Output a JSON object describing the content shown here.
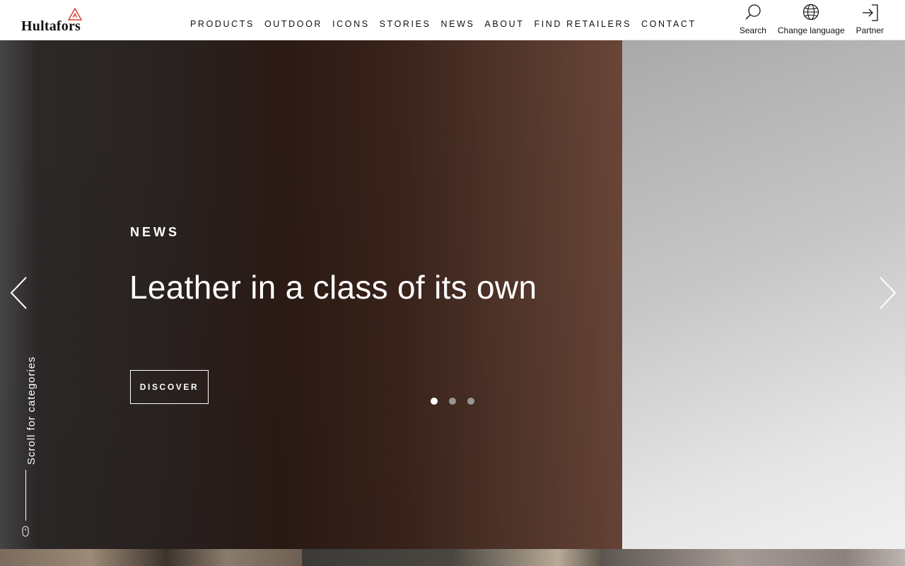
{
  "brand": {
    "name": "Hultafors",
    "accent": "#d63a2f"
  },
  "nav": {
    "items": [
      {
        "label": "PRODUCTS"
      },
      {
        "label": "OUTDOOR"
      },
      {
        "label": "ICONS"
      },
      {
        "label": "STORIES"
      },
      {
        "label": "NEWS"
      },
      {
        "label": "ABOUT"
      },
      {
        "label": "FIND RETAILERS"
      },
      {
        "label": "CONTACT"
      }
    ]
  },
  "tools": {
    "search": {
      "label": "Search",
      "icon": "search-icon"
    },
    "language": {
      "label": "Change language",
      "icon": "globe-icon"
    },
    "partner": {
      "label": "Partner",
      "icon": "login-icon"
    }
  },
  "hero": {
    "kicker": "NEWS",
    "headline": "Leather in a class of its own",
    "cta_label": "DISCOVER",
    "slides": {
      "count": 3,
      "active": 1
    },
    "scroll_label": "Scroll for categories"
  }
}
